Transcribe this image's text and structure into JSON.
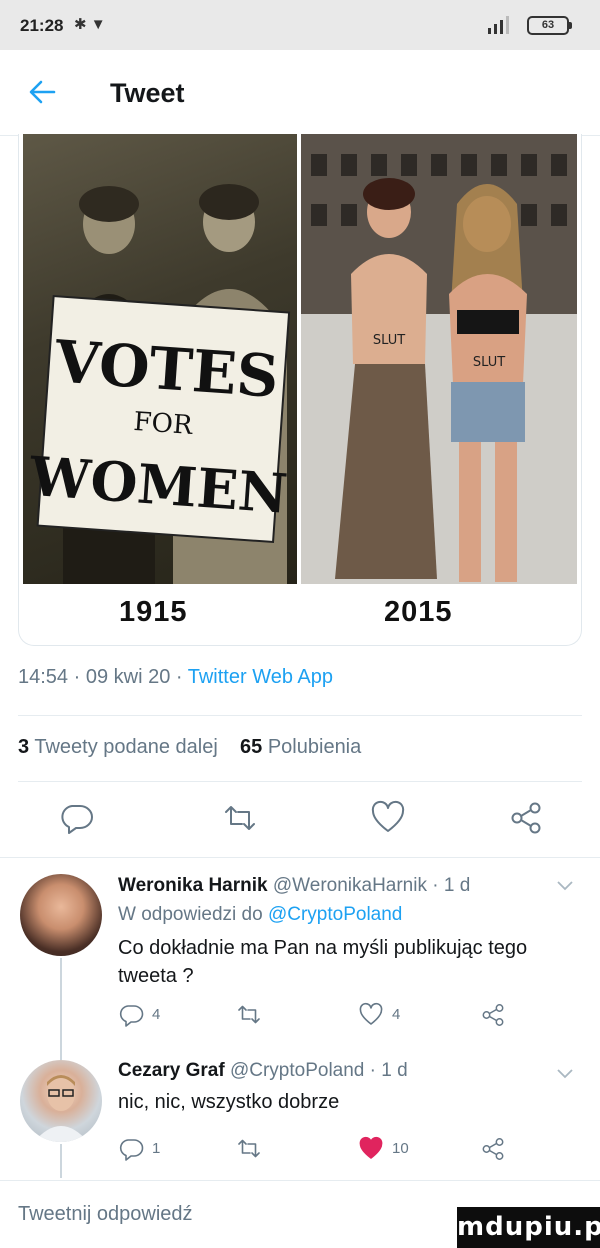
{
  "status_bar": {
    "time": "21:28",
    "left_icons": "✱ ▼",
    "battery": "63"
  },
  "header": {
    "title": "Tweet"
  },
  "tweet": {
    "media": {
      "left_caption": "1915",
      "right_caption": "2015"
    },
    "timestamp": "14:54 · 09 kwi 20 · ",
    "source": "Twitter Web App",
    "retweets_count": "3",
    "retweets_label": "Tweety podane dalej",
    "likes_count": "65",
    "likes_label": "Polubienia"
  },
  "replies": [
    {
      "name": "Weronika Harnik",
      "handle": "@WeronikaHarnik · 1 d",
      "reply_prefix": "W odpowiedzi do ",
      "reply_to": "@CryptoPoland",
      "text": "Co dokładnie ma Pan na myśli publikując tego tweeta ?",
      "reply_count": "4",
      "retweet_count": "",
      "like_count": "4",
      "liked": false
    },
    {
      "name": "Cezary Graf",
      "handle": "@CryptoPoland · 1 d",
      "text": "nic, nic, wszystko dobrze",
      "reply_count": "1",
      "retweet_count": "",
      "like_count": "10",
      "liked": true
    }
  ],
  "compose": {
    "placeholder": "Tweetnij odpowiedź"
  },
  "watermark": "mdupiu.pl",
  "colors": {
    "accent": "#1da1f2",
    "like_red": "#e0245e",
    "muted": "#657786"
  }
}
